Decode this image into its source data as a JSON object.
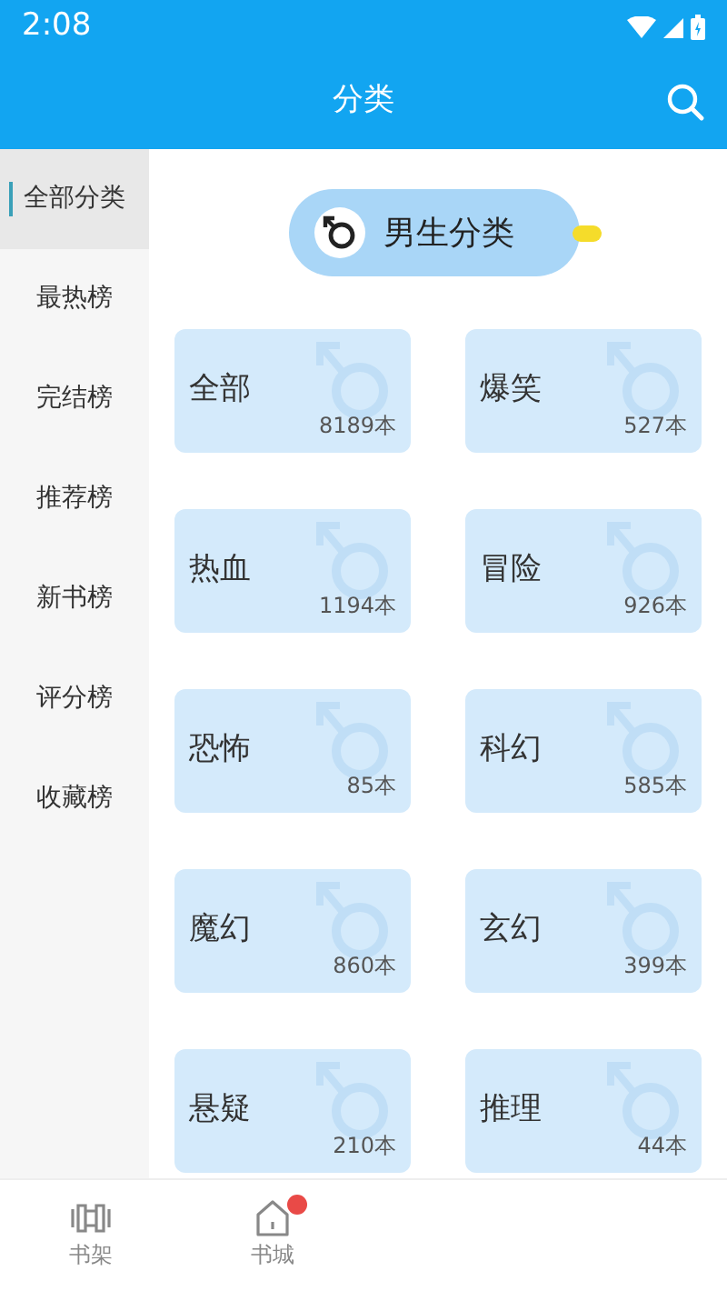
{
  "status_bar": {
    "time": "2:08"
  },
  "app_bar": {
    "title": "分类"
  },
  "sidebar": {
    "items": [
      {
        "label": "全部分类",
        "selected": true
      },
      {
        "label": "最热榜",
        "selected": false
      },
      {
        "label": "完结榜",
        "selected": false
      },
      {
        "label": "推荐榜",
        "selected": false
      },
      {
        "label": "新书榜",
        "selected": false
      },
      {
        "label": "评分榜",
        "selected": false
      },
      {
        "label": "收藏榜",
        "selected": false
      }
    ]
  },
  "section": {
    "label": "男生分类"
  },
  "categories": [
    {
      "name": "全部",
      "count": "8189本"
    },
    {
      "name": "爆笑",
      "count": "527本"
    },
    {
      "name": "热血",
      "count": "1194本"
    },
    {
      "name": "冒险",
      "count": "926本"
    },
    {
      "name": "恐怖",
      "count": "85本"
    },
    {
      "name": "科幻",
      "count": "585本"
    },
    {
      "name": "魔幻",
      "count": "860本"
    },
    {
      "name": "玄幻",
      "count": "399本"
    },
    {
      "name": "悬疑",
      "count": "210本"
    },
    {
      "name": "推理",
      "count": "44本"
    }
  ],
  "bottom_nav": [
    {
      "label": "书架",
      "kind": "shelf",
      "selected": false,
      "badge": false
    },
    {
      "label": "书城",
      "kind": "home",
      "selected": false,
      "badge": true
    }
  ]
}
